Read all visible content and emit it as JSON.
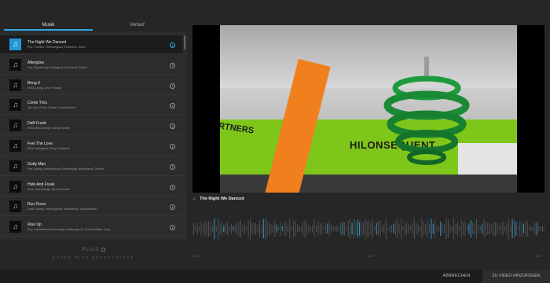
{
  "tabs": {
    "music": "Musik",
    "history": "Verlauf"
  },
  "tracks": [
    {
      "title": "The Night We Danced",
      "tags": "Pop, Fröhlich, Hoffnungsvoll, Erhebend, Warm",
      "active": true
    },
    {
      "title": "Afterglow",
      "tags": "Pop, Beschwingt, Aufregend, Erhebend, Dunkel"
    },
    {
      "title": "Bring It",
      "tags": "EDM, Lustig, Sexy, Peppig"
    },
    {
      "title": "Come Thru",
      "tags": "Hip-Hop, Frech, Dunkel, Zuversichtlich"
    },
    {
      "title": "Daft Crunk",
      "tags": "EDM, Beschwingt, Lässig, Dunkel"
    },
    {
      "title": "Feel The Love",
      "tags": "EDM, Aufregend, Sexy, Erhebend"
    },
    {
      "title": "Gutty Man",
      "tags": "Pop, Lässig, Hoffnungsvoll, Beschwingt, Belustigend, Dunkel"
    },
    {
      "title": "Hide And Freak",
      "tags": "Kinie, Beschwingt, Skurril, Dunkel"
    },
    {
      "title": "Run Down",
      "tags": "Land, Lässig, Hoffnungsvoll, Beschwingt, Zuversichtlich"
    },
    {
      "title": "Rise Up",
      "tags": "Pop, Inspirierend, Beschwingt, Hoffnungsvoll, Zuversichtlich, Sexy"
    }
  ],
  "plus": {
    "logo": "PLUS",
    "subtitle": "GOPRO PLUS SOUNDTRACKS"
  },
  "player": {
    "now_playing": "The Night We Danced",
    "note_icon": "music-note-icon"
  },
  "video": {
    "wall_text": "HILONSEQUENT",
    "wall_text_left": "ARTNERS"
  },
  "timeline": {
    "labels": [
      "0:00",
      "0:15",
      "0:30"
    ]
  },
  "footer": {
    "cancel": "ABBRECHEN",
    "add": "ZU VIDEO HINZUFÜGEN"
  },
  "colors": {
    "accent": "#2fa9e0",
    "background": "#262626"
  }
}
